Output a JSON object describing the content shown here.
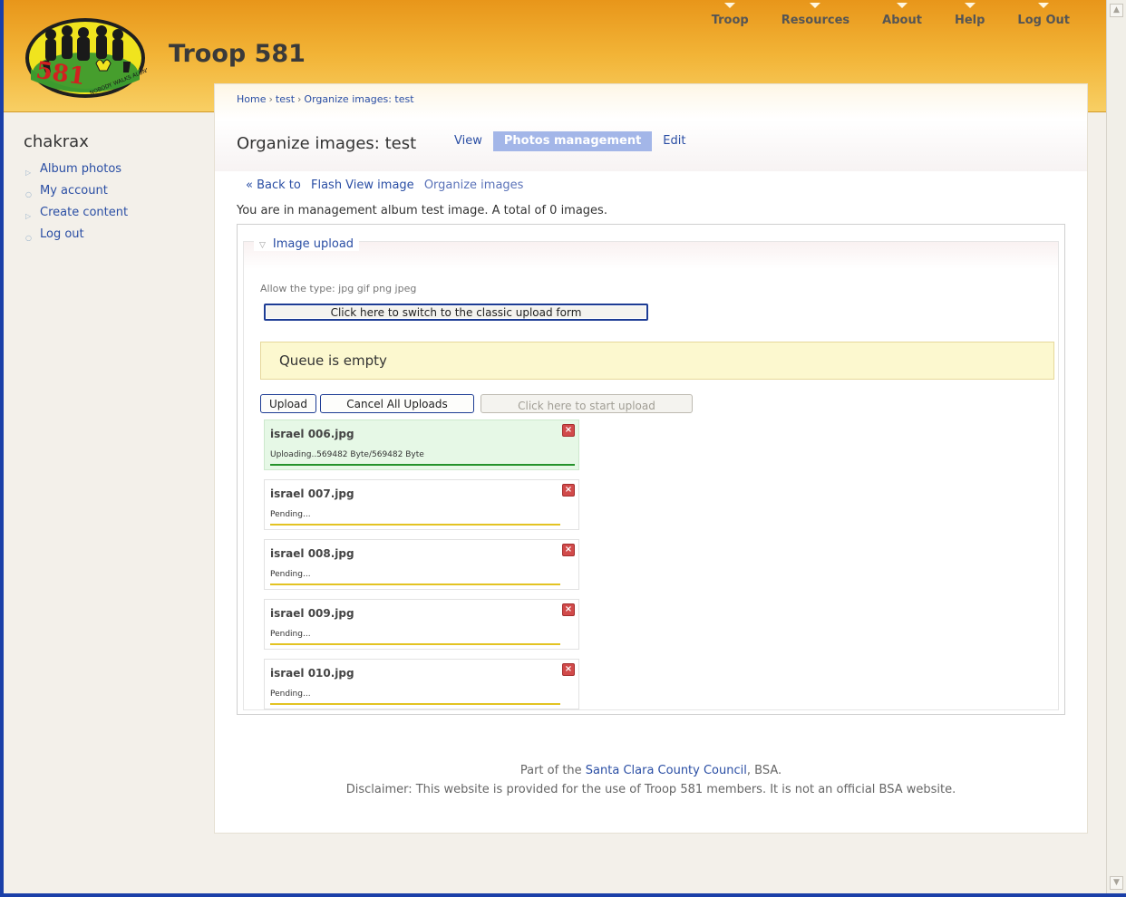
{
  "header": {
    "site_title": "Troop 581",
    "logo_text": "581",
    "logo_motto": "NOBODY WALKS ALONE",
    "nav": [
      "Troop",
      "Resources",
      "About",
      "Help",
      "Log Out"
    ]
  },
  "sidebar": {
    "user": "chakrax",
    "items": [
      {
        "label": "Album photos",
        "icon": "triangle-bullet"
      },
      {
        "label": "My account",
        "icon": "circle-bullet"
      },
      {
        "label": "Create content",
        "icon": "triangle-bullet"
      },
      {
        "label": "Log out",
        "icon": "circle-bullet"
      }
    ]
  },
  "breadcrumb": [
    "Home",
    "test",
    "Organize images: test"
  ],
  "page_title": "Organize images: test",
  "tabs": [
    {
      "label": "View",
      "active": false
    },
    {
      "label": "Photos management",
      "active": true
    },
    {
      "label": "Edit",
      "active": false
    }
  ],
  "links": {
    "back": "« Back to",
    "flash_view": "Flash View image",
    "organize": "Organize images"
  },
  "intro": "You are in management album test image. A total of 0 images.",
  "upload": {
    "legend": "Image upload",
    "allow": "Allow the type: jpg gif png jpeg",
    "classic_button": "Click here to switch to the classic upload form",
    "queue_message": "Queue is empty",
    "upload_button": "Upload",
    "cancel_button": "Cancel All Uploads",
    "start_button": "Click here to start upload",
    "files": [
      {
        "name": "israel 006.jpg",
        "status": "Uploading..569482 Byte/569482 Byte",
        "progress": 1.0,
        "state": "uploading"
      },
      {
        "name": "israel 007.jpg",
        "status": "Pending...",
        "progress": 0,
        "state": "pending"
      },
      {
        "name": "israel 008.jpg",
        "status": "Pending...",
        "progress": 0,
        "state": "pending"
      },
      {
        "name": "israel 009.jpg",
        "status": "Pending...",
        "progress": 0,
        "state": "pending"
      },
      {
        "name": "israel 010.jpg",
        "status": "Pending...",
        "progress": 0,
        "state": "pending"
      }
    ]
  },
  "footer": {
    "part_of_prefix": "Part of the ",
    "council": "Santa Clara County Council",
    "part_of_suffix": ", BSA.",
    "disclaimer": "Disclaimer: This website is provided for the use of Troop 581 members. It is not an official BSA website."
  },
  "colors": {
    "header_top": "#e8961a",
    "header_bottom": "#f8cf64",
    "link": "#2a4ea4",
    "active_tab": "#a3b6e8",
    "queue_bg": "#fcf8cf",
    "upload_done_bar": "#24922a",
    "pending_bar": "#e3c322"
  }
}
